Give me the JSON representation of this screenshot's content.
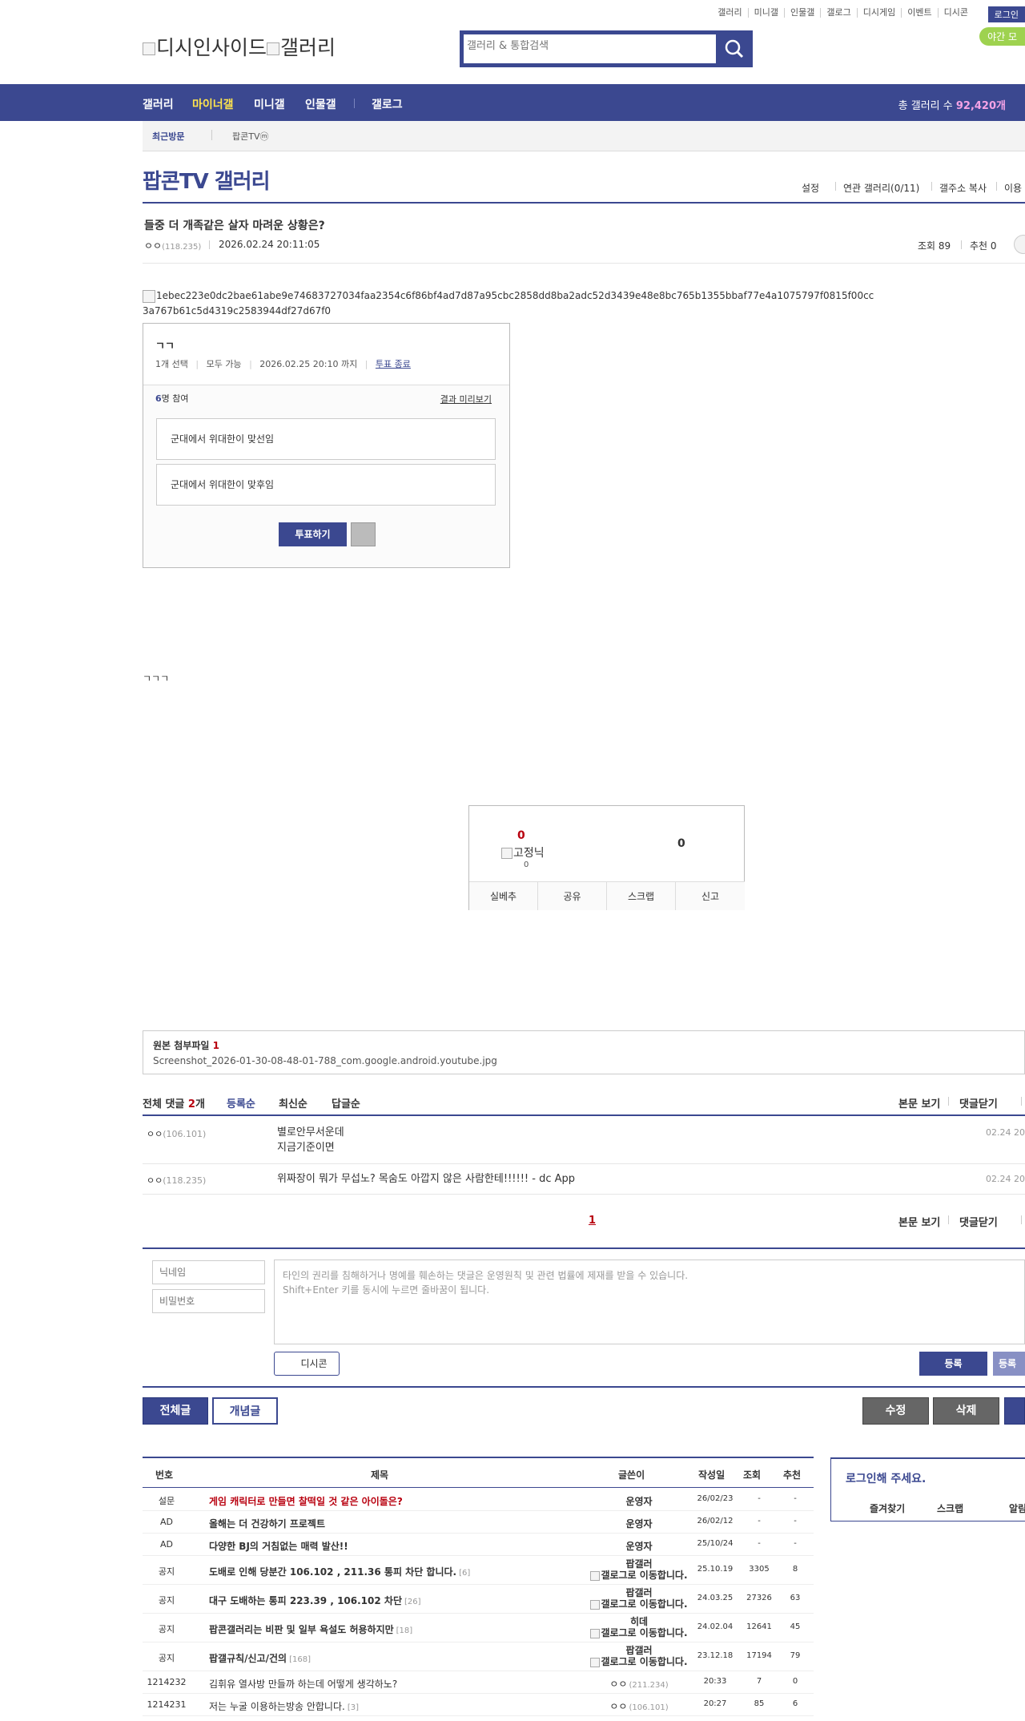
{
  "top_menu": [
    "갤러리",
    "미니갤",
    "인물갤",
    "갤로그",
    "디시게임",
    "이벤트",
    "디시콘"
  ],
  "login_label": "로그인",
  "night_label": "야간 모",
  "logo_alt": [
    "디시인사이드",
    "갤러리"
  ],
  "search": {
    "placeholder": "갤러리 & 통합검색"
  },
  "nav": {
    "items": [
      "갤러리",
      "마이너갤",
      "미니갤",
      "인물갤",
      "갤로그"
    ],
    "total_label": "총 갤러리 수",
    "total_value": "92,420개"
  },
  "recent": {
    "label": "최근방문",
    "items": [
      "팝콘TVⓜ"
    ]
  },
  "gallery": {
    "title": "팝콘TV 갤러리",
    "options": [
      "설정",
      "연관 갤러리(0/11)",
      "갤주소 복사",
      "이용"
    ]
  },
  "post": {
    "title": "들중 더 개족같은 살자 마려운 상황은?",
    "author": "ㅇㅇ",
    "ip": "(118.235)",
    "date": "2026.02.24 20:11:05",
    "views": "조회 89",
    "recommends": "추천 0",
    "image_alt": "1ebec223e0dc2bae61abe9e74683727034faa2354c6f86bf4ad7d87a95cbc2858dd8ba2adc52d3439e48e8bc765b1355bbaf77e4a1075797f0815f00cc3a767b61c5d4319c2583944df27d67f0",
    "body_text": "ㄱㄱㄱ"
  },
  "poll": {
    "title": "ㄱㄱ",
    "select": "1개 선택",
    "scope": "모두 가능",
    "deadline": "2026.02.25 20:10 까지",
    "end_link": "투표 종료",
    "participants_count": "6",
    "participants_suffix": "명 참여",
    "preview": "결과 미리보기",
    "options": [
      "군대에서 위대한이 맞선임",
      "군대에서 위대한이 맞후임"
    ],
    "vote_label": "투표하기"
  },
  "recommend": {
    "up": "0",
    "fixed_alt": "고정닉",
    "fixed_count": "0",
    "down": "0",
    "buttons": [
      "실베추",
      "공유",
      "스크랩",
      "신고"
    ]
  },
  "attachment": {
    "label": "원본 첨부파일",
    "count": "1",
    "file": "Screenshot_2026-01-30-08-48-01-788_com.google.android.youtube.jpg"
  },
  "comments": {
    "label": "전체 댓글",
    "count": "2",
    "count_suffix": "개",
    "sort": [
      "등록순",
      "최신순",
      "답글순"
    ],
    "actions": [
      "본문 보기",
      "댓글닫기"
    ],
    "list": [
      {
        "name": "ㅇㅇ",
        "ip": "(106.101)",
        "lines": [
          "별로안무서운데",
          "지금기준이면"
        ],
        "date": "02.24 20"
      },
      {
        "name": "ㅇㅇ",
        "ip": "(118.235)",
        "lines": [
          "위짜장이 뭐가 무섭노? 목숨도 아깝지 않은 사람한테!!!!!! - dc App"
        ],
        "date": "02.24 20"
      }
    ],
    "page": "1"
  },
  "comment_form": {
    "nick_placeholder": "닉네임",
    "pw_placeholder": "비밀번호",
    "notice": [
      "타인의 권리를 침해하거나 명예를 훼손하는 댓글은 운영원칙 및 관련 법률에 제재를 받을 수 있습니다.",
      "Shift+Enter 키를 동시에 누르면 줄바꿈이 됩니다."
    ],
    "dccon": "디시콘",
    "submit": "등록",
    "submit2": "등록"
  },
  "list_buttons": {
    "all": "전체글",
    "concept": "개념글",
    "edit": "수정",
    "delete": "삭제"
  },
  "table": {
    "headers": [
      "번호",
      "제목",
      "글쓴이",
      "작성일",
      "조회",
      "추천"
    ],
    "rows": [
      {
        "no": "설문",
        "title": "게임 캐릭터로 만들면 찰떡일 것 같은 아이돌은?",
        "red": true,
        "cnt": "",
        "author": "운영자",
        "author_img": "",
        "date": "26/02/23",
        "views": "-",
        "rec": "-",
        "ip": ""
      },
      {
        "no": "AD",
        "title": "올해는 더 건강하기 프로젝트",
        "red": false,
        "cnt": "",
        "author": "운영자",
        "author_img": "",
        "date": "26/02/12",
        "views": "-",
        "rec": "-",
        "ip": ""
      },
      {
        "no": "AD",
        "title": "다양한 BJ의 거침없는 매력 발산!!",
        "red": false,
        "cnt": "",
        "author": "운영자",
        "author_img": "",
        "date": "25/10/24",
        "views": "-",
        "rec": "-",
        "ip": ""
      },
      {
        "no": "공지",
        "title": "도배로 인해 당분간 106.102 , 211.36 통피 차단 합니다.",
        "red": false,
        "cnt": "[6]",
        "author": "팝갤러",
        "author_img": "갤로그로 이동합니다.",
        "date": "25.10.19",
        "views": "3305",
        "rec": "8",
        "ip": ""
      },
      {
        "no": "공지",
        "title": "대구 도배하는 통피 223.39 , 106.102 차단",
        "red": false,
        "cnt": "[26]",
        "author": "팝갤러",
        "author_img": "갤로그로 이동합니다.",
        "date": "24.03.25",
        "views": "27326",
        "rec": "63",
        "ip": ""
      },
      {
        "no": "공지",
        "title": "팝콘갤러리는 비판 및 일부 욕설도 허용하지만",
        "red": false,
        "cnt": "[18]",
        "author": "히데",
        "author_img": "갤로그로 이동합니다.",
        "date": "24.02.04",
        "views": "12641",
        "rec": "45",
        "ip": ""
      },
      {
        "no": "공지",
        "title": "팝갤규칙/신고/건의",
        "red": false,
        "cnt": "[168]",
        "author": "팝갤러",
        "author_img": "갤로그로 이동합니다.",
        "date": "23.12.18",
        "views": "17194",
        "rec": "79",
        "ip": ""
      },
      {
        "no": "1214232",
        "title": "김휘유 열사방 만들까 하는데 어떻게 생각하노?",
        "red": false,
        "cnt": "",
        "author": "ㅇㅇ",
        "author_img": "",
        "date": "20:33",
        "views": "7",
        "rec": "0",
        "ip": "(211.234)"
      },
      {
        "no": "1214231",
        "title": "저는 누굴 이용하는방송 안합니다.",
        "red": false,
        "cnt": "[3]",
        "author": "ㅇㅇ",
        "author_img": "",
        "date": "20:27",
        "views": "85",
        "rec": "6",
        "ip": "(106.101)"
      }
    ]
  },
  "login_box": {
    "title": "로그인해 주세요.",
    "links": [
      "즐겨찾기",
      "스크랩",
      "알림"
    ]
  },
  "colors": {
    "brand": "#3b4890",
    "nav_highlight": "#ffe44d",
    "title_red": "#b8000f"
  }
}
